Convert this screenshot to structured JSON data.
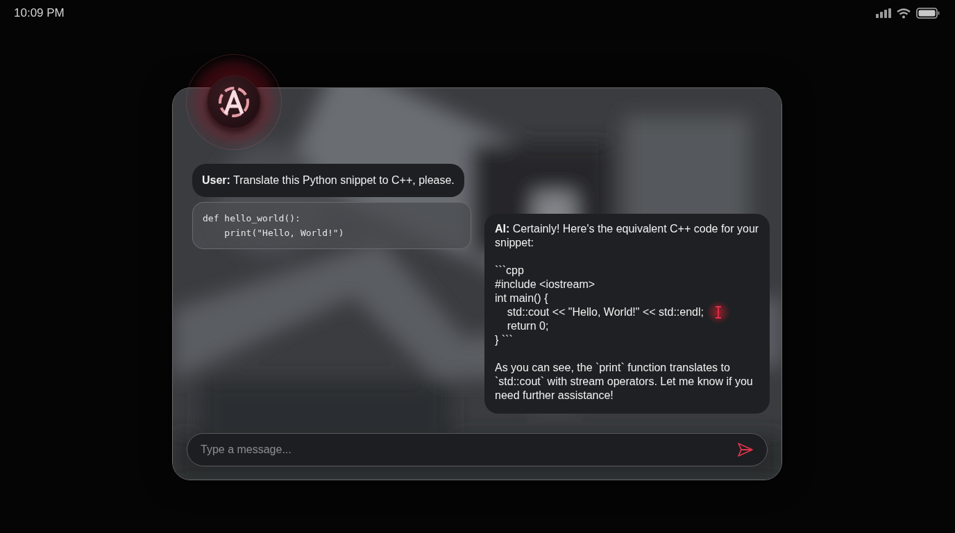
{
  "status_bar": {
    "time": "10:09 PM"
  },
  "messages": [
    {
      "kind": "user",
      "text": "**User:** Translate this Python snippet to C++, please."
    },
    {
      "kind": "code",
      "lines": [
        "def hello_world():",
        "    print(\"Hello, World!\")"
      ]
    },
    {
      "kind": "assistant",
      "intro": "**AI:** Certainly! Here's the equivalent C++ code for your snippet:",
      "code_lines": [
        "```cpp",
        "#include <iostream>",
        "int main() {",
        "    std::cout << \"Hello, World!\" << std::endl;",
        "    return 0;",
        "} ```"
      ],
      "outro": "As you can see, the `print` function translates to `std::cout` with stream operators. Let me know if you need further assistance!"
    }
  ],
  "composer": {
    "placeholder": "Type a message..."
  }
}
